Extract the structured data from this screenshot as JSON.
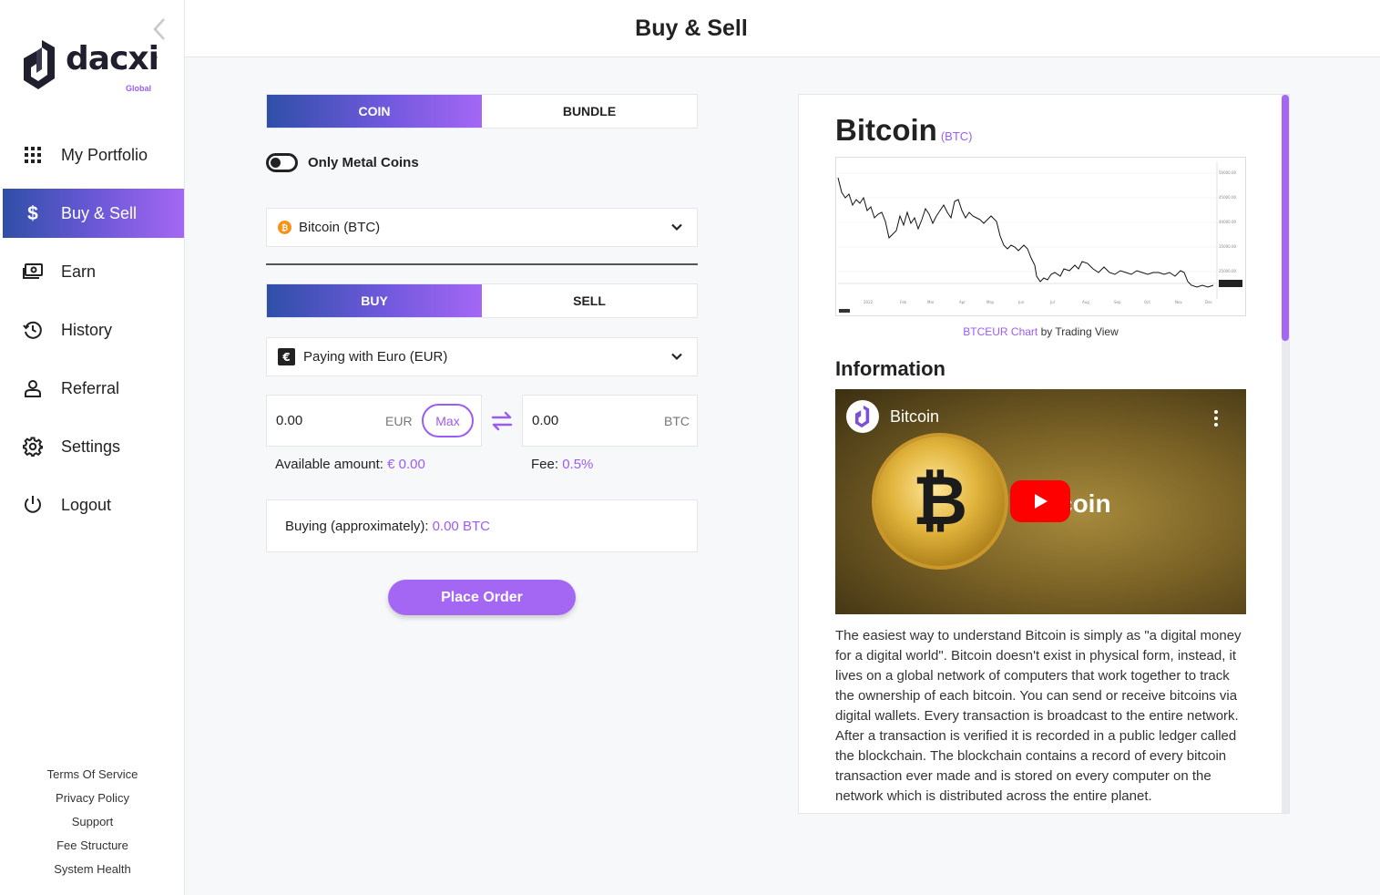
{
  "brand": {
    "name": "dacxi",
    "registered": "®",
    "tagline": "Global"
  },
  "header": {
    "title": "Buy & Sell"
  },
  "sidebar": {
    "items": [
      {
        "label": "My Portfolio",
        "icon": "grid-icon",
        "active": false
      },
      {
        "label": "Buy & Sell",
        "icon": "dollar-icon",
        "active": true
      },
      {
        "label": "Earn",
        "icon": "cash-icon",
        "active": false
      },
      {
        "label": "History",
        "icon": "history-icon",
        "active": false
      },
      {
        "label": "Referral",
        "icon": "user-icon",
        "active": false
      },
      {
        "label": "Settings",
        "icon": "gear-icon",
        "active": false
      },
      {
        "label": "Logout",
        "icon": "power-icon",
        "active": false
      }
    ],
    "footer_links": [
      "Terms Of Service",
      "Privacy Policy",
      "Support",
      "Fee Structure",
      "System Health"
    ]
  },
  "trade": {
    "type_tabs": {
      "coin": "COIN",
      "bundle": "BUNDLE",
      "selected": "COIN"
    },
    "only_metal_label": "Only Metal Coins",
    "only_metal_on": false,
    "asset_select": "Bitcoin (BTC)",
    "side_tabs": {
      "buy": "BUY",
      "sell": "SELL",
      "selected": "BUY"
    },
    "payment_select": "Paying with Euro (EUR)",
    "from": {
      "value": "0.00",
      "currency": "EUR",
      "max_label": "Max"
    },
    "to": {
      "value": "0.00",
      "currency": "BTC"
    },
    "available_label": "Available amount:",
    "available_value": "€ 0.00",
    "fee_label": "Fee:",
    "fee_value": "0.5%",
    "approx_label": "Buying (approximately):",
    "approx_value": "0.00 BTC",
    "place_order": "Place Order"
  },
  "coin_info": {
    "name": "Bitcoin",
    "symbol": "(BTC)",
    "chart_link": "BTCEUR Chart",
    "chart_by": " by Trading View",
    "info_heading": "Information",
    "video_title": "Bitcoin",
    "video_overlay_word": "coin",
    "description": "The easiest way to understand Bitcoin is simply as \"a digital money for a digital world\". Bitcoin doesn't exist in physical form, instead, it lives on a global network of computers that work together to track the ownership of each bitcoin. You can send or receive bitcoins via digital wallets. Every transaction is broadcast to the entire network. After a transaction is verified it is recorded in a public ledger called the blockchain. The blockchain contains a record of every bitcoin transaction ever made and is stored on every computer on the network which is distributed across the entire planet."
  },
  "colors": {
    "accent": "#a467f4",
    "gradient_start": "#2f4fa7",
    "text": "#222222",
    "bitcoin_orange": "#f7931a",
    "youtube_red": "#ff0000"
  }
}
